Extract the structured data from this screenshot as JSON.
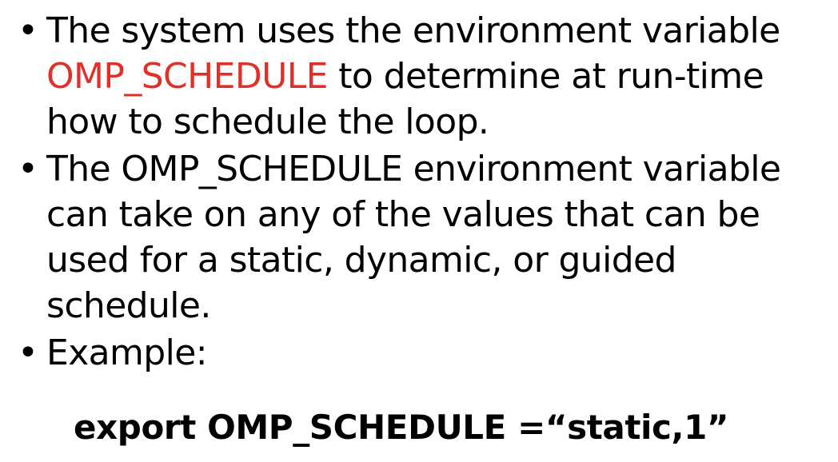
{
  "bullets": [
    {
      "before": "The system uses the environment variable ",
      "highlight": "OMP_SCHEDULE",
      "after": " to determine at run-time how to schedule the loop."
    },
    {
      "text": "The OMP_SCHEDULE environment variable can take on any of the values that can be used for a static, dynamic, or guided schedule."
    },
    {
      "text": "Example:"
    }
  ],
  "bullet_symbol": "•",
  "code": "export OMP_SCHEDULE =“static,1”",
  "colors": {
    "highlight": "#e0302a",
    "text": "#000000",
    "background": "#ffffff"
  }
}
